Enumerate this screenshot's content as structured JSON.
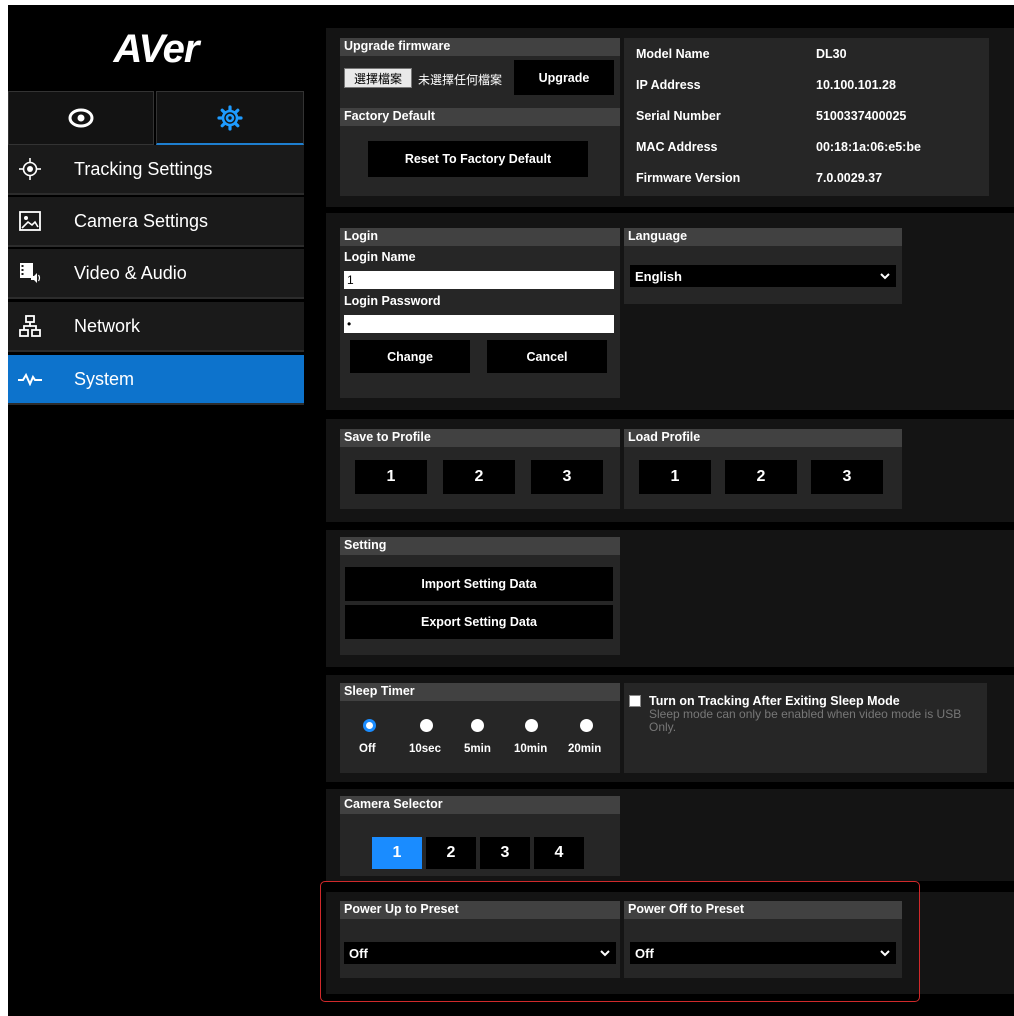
{
  "sidebar": {
    "logo": "AVer",
    "menu": [
      {
        "label": "Tracking Settings",
        "icon": "crosshair-icon"
      },
      {
        "label": "Camera Settings",
        "icon": "image-icon"
      },
      {
        "label": "Video & Audio",
        "icon": "video-audio-icon"
      },
      {
        "label": "Network",
        "icon": "network-icon"
      },
      {
        "label": "System",
        "icon": "pulse-icon"
      }
    ],
    "active": "System"
  },
  "firmware": {
    "title": "Upgrade firmware",
    "choose_file": "選擇檔案",
    "no_file": "未選擇任何檔案",
    "upgrade": "Upgrade"
  },
  "factory": {
    "title": "Factory Default",
    "reset": "Reset To Factory Default"
  },
  "device_info": [
    {
      "label": "Model Name",
      "value": "DL30"
    },
    {
      "label": "IP Address",
      "value": "10.100.101.28"
    },
    {
      "label": "Serial Number",
      "value": "5100337400025"
    },
    {
      "label": "MAC Address",
      "value": "00:18:1a:06:e5:be"
    },
    {
      "label": "Firmware Version",
      "value": "7.0.0029.37"
    }
  ],
  "login": {
    "title": "Login",
    "name_label": "Login Name",
    "name_value": "1",
    "password_label": "Login Password",
    "password_value": "•",
    "change": "Change",
    "cancel": "Cancel"
  },
  "language": {
    "title": "Language",
    "selected": "English"
  },
  "save_profile": {
    "title": "Save to Profile",
    "buttons": [
      "1",
      "2",
      "3"
    ]
  },
  "load_profile": {
    "title": "Load Profile",
    "buttons": [
      "1",
      "2",
      "3"
    ]
  },
  "setting": {
    "title": "Setting",
    "import": "Import Setting Data",
    "export": "Export Setting Data"
  },
  "sleep_timer": {
    "title": "Sleep Timer",
    "options": [
      "Off",
      "10sec",
      "5min",
      "10min",
      "20min"
    ],
    "selected": "Off"
  },
  "tracking_after_sleep": {
    "label": "Turn on Tracking After Exiting Sleep Mode",
    "note": "Sleep mode can only be enabled when video mode is USB Only.",
    "checked": false
  },
  "camera_selector": {
    "title": "Camera Selector",
    "buttons": [
      "1",
      "2",
      "3",
      "4"
    ],
    "selected": "1"
  },
  "power_up": {
    "title": "Power Up to Preset",
    "selected": "Off"
  },
  "power_off": {
    "title": "Power Off to Preset",
    "selected": "Off"
  },
  "colors": {
    "accent": "#0d73cc",
    "highlight": "#d0292b"
  }
}
